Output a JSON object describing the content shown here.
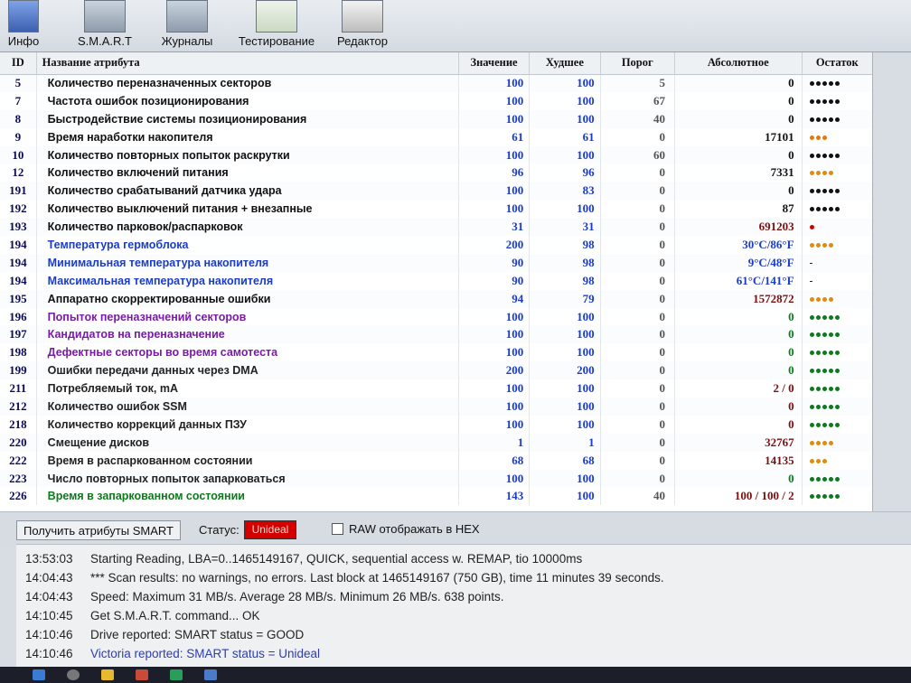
{
  "toolbar": {
    "buttons": [
      {
        "label": "Инфо",
        "icon": "info-icon"
      },
      {
        "label": "S.M.A.R.T",
        "icon": "smart-icon"
      },
      {
        "label": "Журналы",
        "icon": "logs-icon"
      },
      {
        "label": "Тестирование",
        "icon": "test-icon"
      },
      {
        "label": "Редактор",
        "icon": "editor-icon"
      }
    ]
  },
  "table": {
    "headers": {
      "id": "ID",
      "name": "Название атрибута",
      "value": "Значение",
      "worst": "Худшее",
      "threshold": "Порог",
      "raw": "Абсолютное",
      "remaining": "Остаток"
    },
    "rows": [
      {
        "id": "5",
        "name": "Количество переназначенных секторов",
        "value": "100",
        "worst": "100",
        "threshold": "5",
        "raw": "0",
        "dots": 5,
        "dot_color": "#111111",
        "name_color": "#111111",
        "raw_color": "#111111"
      },
      {
        "id": "7",
        "name": "Частота ошибок позиционирования",
        "value": "100",
        "worst": "100",
        "threshold": "67",
        "raw": "0",
        "dots": 5,
        "dot_color": "#111111",
        "name_color": "#111111",
        "raw_color": "#111111"
      },
      {
        "id": "8",
        "name": "Быстродействие системы позиционирования",
        "value": "100",
        "worst": "100",
        "threshold": "40",
        "raw": "0",
        "dots": 5,
        "dot_color": "#111111",
        "name_color": "#111111",
        "raw_color": "#111111"
      },
      {
        "id": "9",
        "name": "Время наработки накопителя",
        "value": "61",
        "worst": "61",
        "threshold": "0",
        "raw": "17101",
        "dots": 3,
        "dot_color": "#e07a10",
        "name_color": "#111111",
        "raw_color": "#111111"
      },
      {
        "id": "10",
        "name": "Количество повторных попыток раскрутки",
        "value": "100",
        "worst": "100",
        "threshold": "60",
        "raw": "0",
        "dots": 5,
        "dot_color": "#111111",
        "name_color": "#111111",
        "raw_color": "#111111"
      },
      {
        "id": "12",
        "name": "Количество включений питания",
        "value": "96",
        "worst": "96",
        "threshold": "0",
        "raw": "7331",
        "dots": 4,
        "dot_color": "#e08a10",
        "name_color": "#111111",
        "raw_color": "#111111"
      },
      {
        "id": "191",
        "name": "Количество срабатываний датчика удара",
        "value": "100",
        "worst": "83",
        "threshold": "0",
        "raw": "0",
        "dots": 5,
        "dot_color": "#111111",
        "name_color": "#111111",
        "raw_color": "#111111"
      },
      {
        "id": "192",
        "name": "Количество выключений питания + внезапные",
        "value": "100",
        "worst": "100",
        "threshold": "0",
        "raw": "87",
        "dots": 5,
        "dot_color": "#111111",
        "name_color": "#111111",
        "raw_color": "#111111"
      },
      {
        "id": "193",
        "name": "Количество парковок/распарковок",
        "value": "31",
        "worst": "31",
        "threshold": "0",
        "raw": "691203",
        "dots": 1,
        "dot_color": "#d00000",
        "name_color": "#111111",
        "raw_color": "#7a1010"
      },
      {
        "id": "194",
        "name": "Температура гермоблока",
        "value": "200",
        "worst": "98",
        "threshold": "0",
        "raw": "30°C/86°F",
        "dots": 4,
        "dot_color": "#e08a10",
        "name_color": "#1a3cc8",
        "raw_color": "#1a3cc8"
      },
      {
        "id": "194",
        "name": "Минимальная температура накопителя",
        "value": "90",
        "worst": "98",
        "threshold": "0",
        "raw": "9°C/48°F",
        "dots": 0,
        "dot_color": "#111111",
        "name_color": "#1a3cc8",
        "raw_color": "#1a3cc8",
        "dash": "-"
      },
      {
        "id": "194",
        "name": "Максимальная температура накопителя",
        "value": "90",
        "worst": "98",
        "threshold": "0",
        "raw": "61°C/141°F",
        "dots": 0,
        "dot_color": "#111111",
        "name_color": "#1a3cc8",
        "raw_color": "#1a3cc8",
        "dash": "-"
      },
      {
        "id": "195",
        "name": "Аппаратно скорректированные ошибки",
        "value": "94",
        "worst": "79",
        "threshold": "0",
        "raw": "1572872",
        "dots": 4,
        "dot_color": "#e08a10",
        "name_color": "#111111",
        "raw_color": "#7a1010"
      },
      {
        "id": "196",
        "name": "Попыток переназначений секторов",
        "value": "100",
        "worst": "100",
        "threshold": "0",
        "raw": "0",
        "dots": 5,
        "dot_color": "#0e7a1e",
        "name_color": "#7a1aa8",
        "raw_color": "#0e7a1e"
      },
      {
        "id": "197",
        "name": "Кандидатов на переназначение",
        "value": "100",
        "worst": "100",
        "threshold": "0",
        "raw": "0",
        "dots": 5,
        "dot_color": "#0e7a1e",
        "name_color": "#7a1aa8",
        "raw_color": "#0e7a1e"
      },
      {
        "id": "198",
        "name": "Дефектные секторы во время самотеста",
        "value": "100",
        "worst": "100",
        "threshold": "0",
        "raw": "0",
        "dots": 5,
        "dot_color": "#0e7a1e",
        "name_color": "#7a1aa8",
        "raw_color": "#0e7a1e"
      },
      {
        "id": "199",
        "name": "Ошибки передачи данных через DMA",
        "value": "200",
        "worst": "200",
        "threshold": "0",
        "raw": "0",
        "dots": 5,
        "dot_color": "#0e7a1e",
        "name_color": "#222222",
        "raw_color": "#0e7a1e"
      },
      {
        "id": "211",
        "name": "Потребляемый ток, mA",
        "value": "100",
        "worst": "100",
        "threshold": "0",
        "raw": "2 / 0",
        "dots": 5,
        "dot_color": "#0e7a1e",
        "name_color": "#222222",
        "raw_color": "#7a1010"
      },
      {
        "id": "212",
        "name": "Количество ошибок SSM",
        "value": "100",
        "worst": "100",
        "threshold": "0",
        "raw": "0",
        "dots": 5,
        "dot_color": "#0e7a1e",
        "name_color": "#222222",
        "raw_color": "#7a1010"
      },
      {
        "id": "218",
        "name": "Количество коррекций данных ПЗУ",
        "value": "100",
        "worst": "100",
        "threshold": "0",
        "raw": "0",
        "dots": 5,
        "dot_color": "#0e7a1e",
        "name_color": "#222222",
        "raw_color": "#7a1010"
      },
      {
        "id": "220",
        "name": "Смещение дисков",
        "value": "1",
        "worst": "1",
        "threshold": "0",
        "raw": "32767",
        "dots": 4,
        "dot_color": "#e08a10",
        "name_color": "#222222",
        "raw_color": "#7a1010"
      },
      {
        "id": "222",
        "name": "Время в распаркованном состоянии",
        "value": "68",
        "worst": "68",
        "threshold": "0",
        "raw": "14135",
        "dots": 3,
        "dot_color": "#e08a10",
        "name_color": "#222222",
        "raw_color": "#7a1010"
      },
      {
        "id": "223",
        "name": "Число повторных попыток запарковаться",
        "value": "100",
        "worst": "100",
        "threshold": "0",
        "raw": "0",
        "dots": 5,
        "dot_color": "#0e7a1e",
        "name_color": "#222222",
        "raw_color": "#0e7a1e"
      },
      {
        "id": "226",
        "name": "Время в запаркованном состоянии",
        "value": "143",
        "worst": "100",
        "threshold": "40",
        "raw": "100 / 100 / 2",
        "dots": 5,
        "dot_color": "#0e7a1e",
        "name_color": "#0e7a1e",
        "raw_color": "#7a1010"
      }
    ]
  },
  "status_bar": {
    "get_button": "Получить атрибуты SMART",
    "status_label": "Статус:",
    "status_value": "Unideal",
    "raw_hex_label": "RAW отображать в HEX"
  },
  "log": [
    {
      "time": "13:53:03",
      "msg": "Starting Reading, LBA=0..1465149167, QUICK, sequential access w. REMAP, tio 10000ms",
      "color": "dark"
    },
    {
      "time": "14:04:43",
      "msg": "*** Scan results: no warnings, no errors. Last block at 1465149167 (750 GB), time 11 minutes 39 seconds.",
      "color": "dark"
    },
    {
      "time": "14:04:43",
      "msg": "Speed: Maximum 31 MB/s. Average 28 MB/s. Minimum 26 MB/s. 638 points.",
      "color": "dark"
    },
    {
      "time": "14:10:45",
      "msg": "Get S.M.A.R.T. command... OK",
      "color": "dark"
    },
    {
      "time": "14:10:46",
      "msg": "Drive reported: SMART status = GOOD",
      "color": "dark"
    },
    {
      "time": "14:10:46",
      "msg": "Victoria reported: SMART status = Unideal",
      "color": "blue"
    }
  ]
}
